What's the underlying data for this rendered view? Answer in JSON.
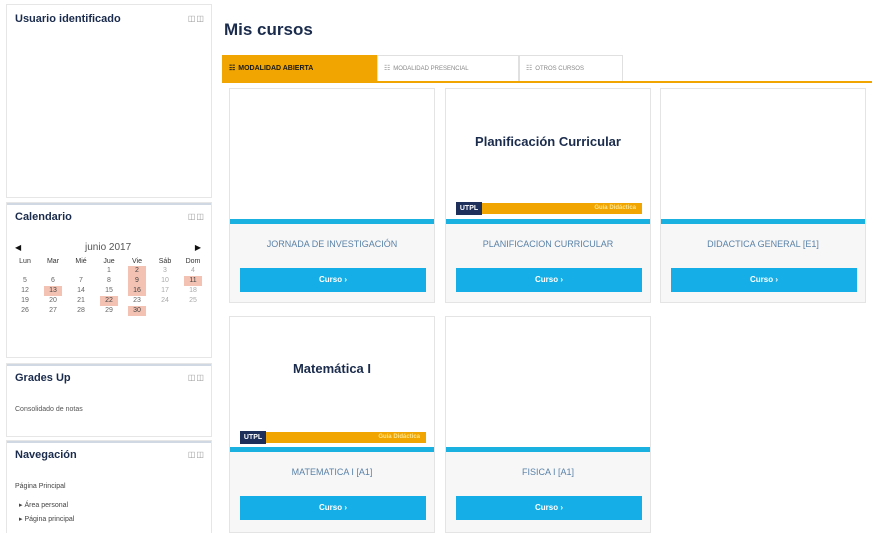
{
  "blocks": {
    "user": {
      "title": "Usuario identificado"
    },
    "calendar": {
      "title": "Calendario",
      "month": "junio 2017",
      "days": [
        "Lun",
        "Mar",
        "Mié",
        "Jue",
        "Vie",
        "Sáb",
        "Dom"
      ],
      "weeks": [
        [
          "",
          "",
          "",
          "1",
          "2",
          "3",
          "4"
        ],
        [
          "5",
          "6",
          "7",
          "8",
          "9",
          "10",
          "11"
        ],
        [
          "12",
          "13",
          "14",
          "15",
          "16",
          "17",
          "18"
        ],
        [
          "19",
          "20",
          "21",
          "22",
          "23",
          "24",
          "25"
        ],
        [
          "26",
          "27",
          "28",
          "29",
          "30",
          "",
          ""
        ]
      ],
      "highlighted": [
        "2",
        "9",
        "11",
        "13",
        "16",
        "22",
        "30"
      ]
    },
    "grades": {
      "title": "Grades Up",
      "item": "Consolidado de notas"
    },
    "nav": {
      "title": "Navegación",
      "items": [
        "Página Principal",
        "Área personal",
        "Página principal"
      ]
    },
    "control_icon": "◫◫"
  },
  "main": {
    "title": "Mis cursos",
    "tabs": [
      {
        "label": "MODALIDAD ABIERTA",
        "active": true
      },
      {
        "label": "MODALIDAD PRESENCIAL",
        "active": false
      },
      {
        "label": "OTROS CURSOS",
        "active": false
      }
    ],
    "tab_icon": "☷",
    "courses": [
      {
        "name": "JORNADA DE INVESTIGACIÓN",
        "cover": "",
        "button": "Curso ›"
      },
      {
        "name": "PLANIFICACION CURRICULAR",
        "cover": "Planificación Curricular",
        "button": "Curso ›"
      },
      {
        "name": "DIDACTICA GENERAL [E1]",
        "cover": "",
        "button": "Curso ›"
      },
      {
        "name": "MATEMATICA I [A1]",
        "cover": "Matemática I",
        "button": "Curso ›"
      },
      {
        "name": "FISICA I [A1]",
        "cover": "",
        "button": "Curso ›"
      }
    ],
    "brand": {
      "logo": "UTPL",
      "guide": "Guía Didáctica"
    }
  },
  "colors": {
    "accent": "#f0a500",
    "button": "#15aee6",
    "title": "#1a2b4c"
  }
}
